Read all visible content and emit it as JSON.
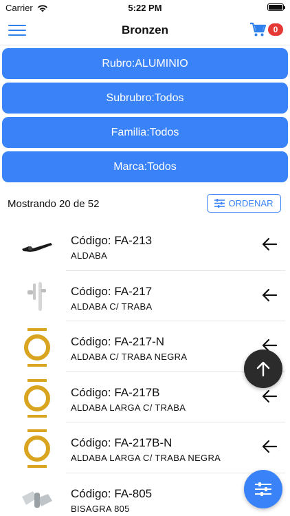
{
  "status_bar": {
    "carrier": "Carrier",
    "time": "5:22 PM"
  },
  "header": {
    "title": "Bronzen",
    "menu_icon": "hamburger-icon",
    "cart_icon": "cart-icon",
    "cart_count": "0"
  },
  "filters": [
    {
      "label": "Rubro:ALUMINIO"
    },
    {
      "label": "Subrubro:Todos"
    },
    {
      "label": "Familia:Todos"
    },
    {
      "label": "Marca:Todos"
    }
  ],
  "results": {
    "showing_text": "Mostrando 20 de 52",
    "order_label": "ORDENAR",
    "order_icon": "sliders-icon"
  },
  "products": [
    {
      "code": "Código: FA-213",
      "description": "ALDABA",
      "image": "latch-handle-icon"
    },
    {
      "code": "Código: FA-217",
      "description": "ALDABA C/ TRABA",
      "image": "latch-lock-icon"
    },
    {
      "code": "Código: FA-217-N",
      "description": "ALDABA C/ TRABA NEGRA",
      "image": "placeholder-logo-icon"
    },
    {
      "code": "Código: FA-217B",
      "description": "ALDABA LARGA C/ TRABA",
      "image": "placeholder-logo-icon"
    },
    {
      "code": "Código: FA-217B-N",
      "description": "ALDABA LARGA C/ TRABA NEGRA",
      "image": "placeholder-logo-icon"
    },
    {
      "code": "Código: FA-805",
      "description": "BISAGRA 805",
      "image": "hinge-icon"
    }
  ],
  "colors": {
    "accent": "#3a82f7",
    "badge": "#e53935",
    "placeholder_logo": "#d9a520",
    "fab_dark": "#2b2b2b"
  }
}
